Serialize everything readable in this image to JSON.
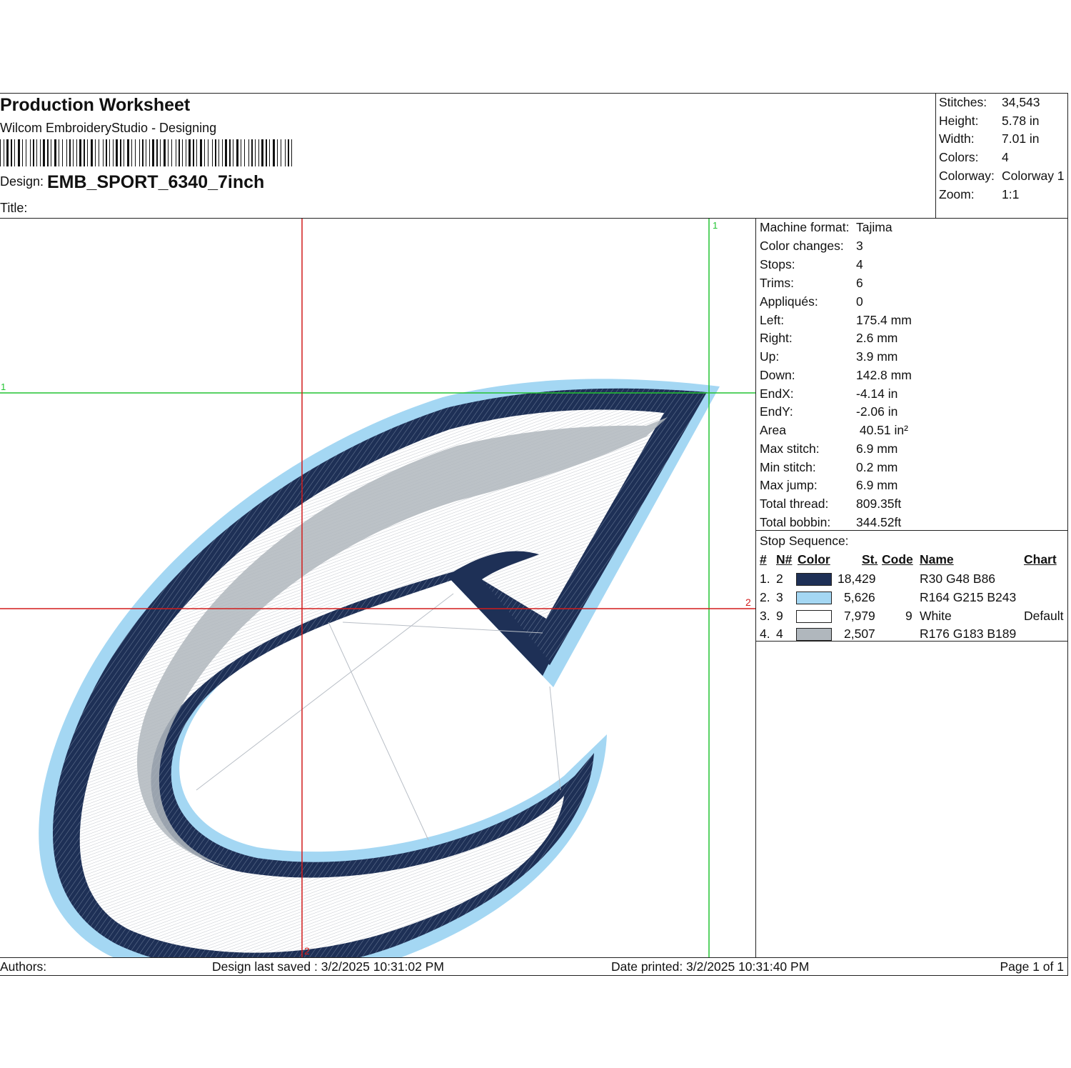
{
  "header": {
    "title": "Production Worksheet",
    "subtitle": "Wilcom EmbroideryStudio - Designing",
    "design_label": "Design:",
    "design_value": "EMB_SPORT_6340_7inch",
    "title_label": "Title:"
  },
  "stats": [
    {
      "label": "Stitches:",
      "value": "34,543"
    },
    {
      "label": "Height:",
      "value": "5.78 in"
    },
    {
      "label": "Width:",
      "value": "7.01 in"
    },
    {
      "label": "Colors:",
      "value": "4"
    },
    {
      "label": "Colorway:",
      "value": "Colorway 1"
    },
    {
      "label": "Zoom:",
      "value": "1:1"
    }
  ],
  "machine": [
    {
      "label": "Machine format:",
      "value": "Tajima"
    },
    {
      "label": "Color changes:",
      "value": "3"
    },
    {
      "label": "Stops:",
      "value": "4"
    },
    {
      "label": "Trims:",
      "value": "6"
    },
    {
      "label": "Appliqués:",
      "value": "0"
    },
    {
      "label": "Left:",
      "value": "175.4 mm"
    },
    {
      "label": "Right:",
      "value": "2.6 mm"
    },
    {
      "label": "Up:",
      "value": "3.9 mm"
    },
    {
      "label": "Down:",
      "value": "142.8 mm"
    },
    {
      "label": "EndX:",
      "value": "-4.14 in"
    },
    {
      "label": "EndY:",
      "value": "-2.06 in"
    },
    {
      "label": "Area",
      "value": " 40.51 in²"
    },
    {
      "label": "Max stitch:",
      "value": "6.9 mm"
    },
    {
      "label": "Min stitch:",
      "value": "0.2 mm"
    },
    {
      "label": "Max jump:",
      "value": "6.9 mm"
    },
    {
      "label": "Total thread:",
      "value": "809.35ft"
    },
    {
      "label": "Total bobbin:",
      "value": "344.52ft"
    }
  ],
  "stop_sequence": {
    "title": "Stop Sequence:",
    "headers": {
      "num": "#",
      "needle": "N#",
      "color": "Color",
      "stitches": "St.",
      "code": "Code",
      "name": "Name",
      "chart": "Chart"
    },
    "rows": [
      {
        "num": "1.",
        "needle": "2",
        "color": "#1E3056",
        "stitches": "18,429",
        "code": "",
        "name": "R30 G48 B86",
        "chart": ""
      },
      {
        "num": "2.",
        "needle": "3",
        "color": "#A4D7F3",
        "stitches": "5,626",
        "code": "",
        "name": "R164 G215 B243",
        "chart": ""
      },
      {
        "num": "3.",
        "needle": "9",
        "color": "#FFFFFF",
        "stitches": "7,979",
        "code": "9",
        "name": "White",
        "chart": "Default"
      },
      {
        "num": "4.",
        "needle": "4",
        "color": "#B0B7BD",
        "stitches": "2,507",
        "code": "",
        "name": "R176 G183 B189",
        "chart": ""
      }
    ]
  },
  "canvas": {
    "guide_green_top": "1",
    "guide_red_right": "2",
    "guide_red_bottom": "2",
    "guide_green_left": "1"
  },
  "footer": {
    "authors": "Authors:",
    "last_saved": "Design last saved : 3/2/2025 10:31:02 PM",
    "printed": "Date printed: 3/2/2025 10:31:40 PM",
    "page": "Page 1 of 1"
  }
}
